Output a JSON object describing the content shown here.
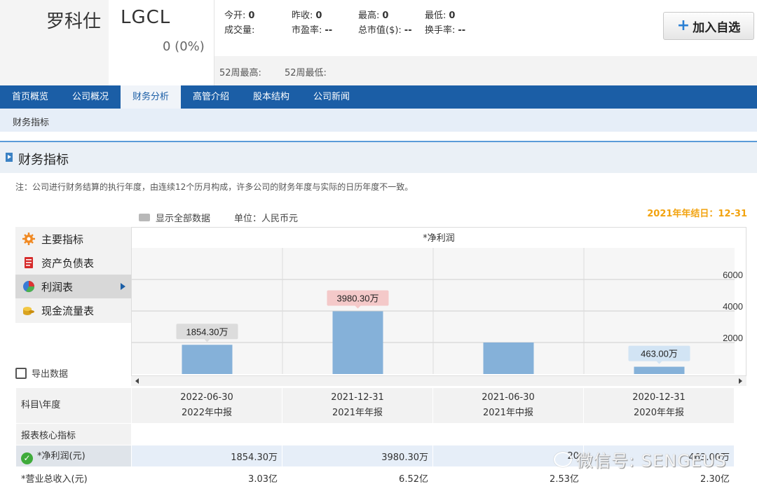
{
  "stock": {
    "name_cn": "罗科仕",
    "code": "LGCL",
    "change": "0 (0%)"
  },
  "quote": {
    "open": {
      "label": "今开:",
      "value": "0"
    },
    "prev_close": {
      "label": "昨收:",
      "value": "0"
    },
    "high": {
      "label": "最高:",
      "value": "0"
    },
    "low": {
      "label": "最低:",
      "value": "0"
    },
    "volume": {
      "label": "成交量:",
      "value": ""
    },
    "pe": {
      "label": "市盈率:",
      "value": "--"
    },
    "market_cap": {
      "label": "总市值($):",
      "value": "--"
    },
    "turnover": {
      "label": "换手率:",
      "value": "--"
    },
    "week52_high": {
      "label": "52周最高:",
      "value": ""
    },
    "week52_low": {
      "label": "52周最低:",
      "value": ""
    }
  },
  "add_watchlist": {
    "label": "加入自选",
    "icon": "plus-icon"
  },
  "nav": {
    "tabs": [
      "首页概览",
      "公司概况",
      "财务分析",
      "高管介绍",
      "股本结构",
      "公司新闻"
    ],
    "active": "财务分析",
    "sub": "财务指标"
  },
  "section": {
    "title": "财务指标",
    "note": "注：公司进行财务结算的执行年度，由连续12个历月构成，许多公司的财务年度与实际的日历年度不一致。",
    "show_all": "显示全部数据",
    "unit": "单位：人民币元",
    "year_end": "2021年年结日：12-31",
    "export": "导出数据"
  },
  "menu": [
    {
      "label": "主要指标",
      "icon": "gear-icon",
      "color": "#f08a24"
    },
    {
      "label": "资产负债表",
      "icon": "document-icon",
      "color": "#d62b2b"
    },
    {
      "label": "利润表",
      "icon": "pie-chart-icon",
      "color": "#3a7bd5"
    },
    {
      "label": "现金流量表",
      "icon": "coins-icon",
      "color": "#d9a320"
    }
  ],
  "menu_active": "利润表",
  "chart_data": {
    "type": "bar",
    "title": "*净利润",
    "categories": [
      "2022-06-30",
      "2021-12-31",
      "2021-06-30",
      "2020-12-31"
    ],
    "values": [
      1854.3,
      3980.3,
      2000.0,
      463.0
    ],
    "data_labels": [
      "1854.30万",
      "3980.30万",
      "",
      "463.00万"
    ],
    "yticks": [
      "2000",
      "4000",
      "6000"
    ],
    "ylim": [
      0,
      8000
    ],
    "bar_color": "#85b1d9",
    "label_colors": [
      "#dcdcdc",
      "#f4c9c9",
      "",
      "#d2e4f4"
    ],
    "grid": true,
    "y_axis_position": "right"
  },
  "table": {
    "corner": "科目\\年度",
    "columns": [
      {
        "date": "2022-06-30",
        "period": "2022年中报"
      },
      {
        "date": "2021-12-31",
        "period": "2021年年报"
      },
      {
        "date": "2021-06-30",
        "period": "2021年中报"
      },
      {
        "date": "2020-12-31",
        "period": "2020年年报"
      }
    ],
    "rows": [
      {
        "label": "报表核心指标",
        "values": [
          "",
          "",
          "",
          ""
        ]
      },
      {
        "label": "*净利润(元)",
        "values": [
          "1854.30万",
          "3980.30万",
          "20",
          "463.00万"
        ]
      },
      {
        "label": "*营业总收入(元)",
        "values": [
          "3.03亿",
          "6.52亿",
          "2.53亿",
          "2.30亿"
        ]
      }
    ]
  },
  "watermark": "微信号: SENGEUS"
}
